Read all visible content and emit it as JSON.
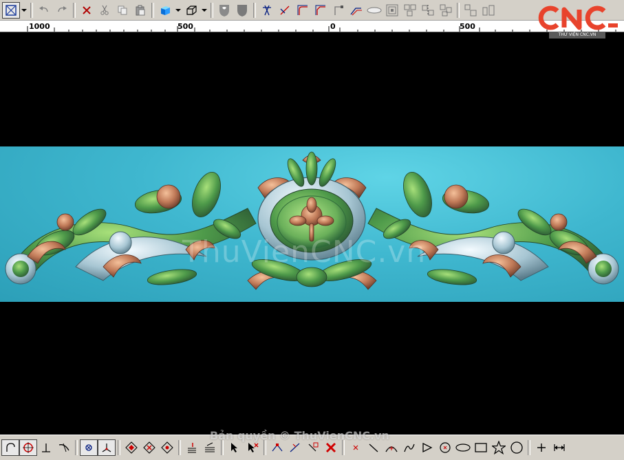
{
  "ruler": {
    "labels": [
      "1000",
      "500",
      "0",
      "500"
    ]
  },
  "watermark": {
    "center_text": "ThuVienCNC.vn",
    "copyright": "Bản quyền © ThuVienCNC.vn"
  },
  "logo": {
    "text": "CNC",
    "caption": "THƯ VIỆN CNC.VN",
    "color": "#e8432c"
  },
  "colors": {
    "toolbar_bg": "#d4d0c8",
    "viewport_bg": "#000000",
    "carving_bg": "#3fb7cf"
  },
  "top_toolbar": {
    "icons": [
      "select-box-icon",
      "undo-icon",
      "redo-icon",
      "delete-icon",
      "cut-icon",
      "copy-icon",
      "paste-icon",
      "shade-icon",
      "wireframe-box-icon",
      "shield-outline-icon",
      "shield-filled-icon",
      "trim-icon",
      "extend-icon",
      "fillet-icon",
      "chamfer-icon",
      "corner-icon",
      "offset-curve-icon",
      "ellipse-flat-icon",
      "nested-square-icon",
      "array-icon",
      "mirror-icon",
      "align-icon"
    ]
  },
  "bottom_toolbar": {
    "icons": [
      "arc-snap-icon",
      "circle-snap-icon",
      "perpendicular-icon",
      "tangent-icon",
      "grid-snap-icon",
      "axis-snap-icon",
      "diamond-icon",
      "diamond-x-icon",
      "diamond-dot-icon",
      "layer-icon",
      "layers-icon",
      "pick-icon",
      "pick-delete-icon",
      "node-edit-icon",
      "node-move-icon",
      "node-insert-icon",
      "delete-x-icon",
      "point-icon",
      "line-icon",
      "arc-icon",
      "spline-icon",
      "polygon-icon",
      "circle-center-icon",
      "ellipse-icon",
      "rectangle-icon",
      "star-icon",
      "circle-icon",
      "cross-icon",
      "dimension-icon"
    ]
  }
}
